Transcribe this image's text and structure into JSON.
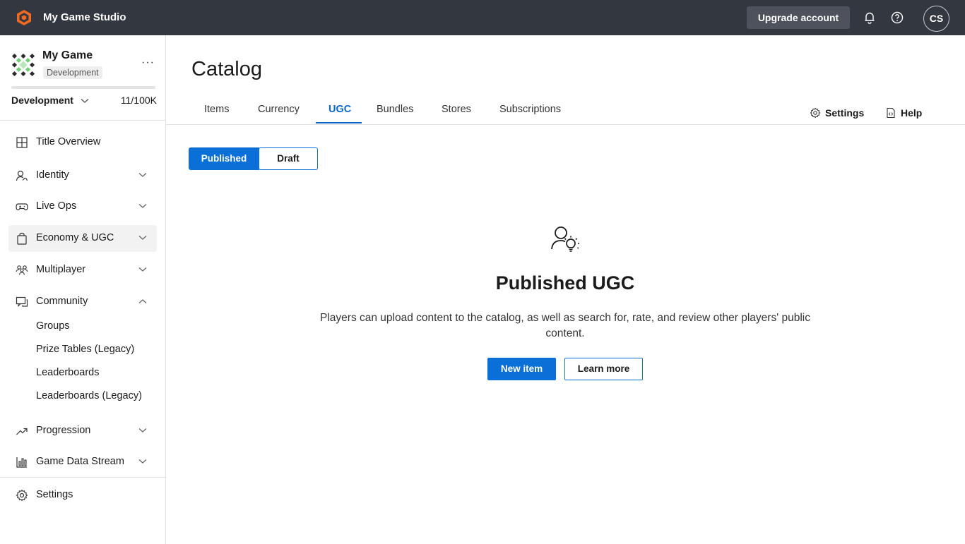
{
  "topbar": {
    "studio_name": "My Game Studio",
    "upgrade_label": "Upgrade account",
    "avatar_initials": "CS",
    "accent": "#f26a21",
    "icons": [
      "logo-icon",
      "bell-icon",
      "help-icon"
    ]
  },
  "sidebar": {
    "game_name": "My Game",
    "env_badge": "Development",
    "more_label": "···",
    "env_select": "Development",
    "usage_count": "11/100K",
    "usage_fraction": 0.00011,
    "items": [
      {
        "label": "Title Overview",
        "icon": "grid-icon"
      },
      {
        "label": "Identity",
        "icon": "identity-icon"
      },
      {
        "label": "Live Ops",
        "icon": "gamepad-icon"
      },
      {
        "label": "Economy & UGC",
        "icon": "bag-icon"
      },
      {
        "label": "Multiplayer",
        "icon": "people-icon"
      },
      {
        "label": "Community",
        "icon": "community-icon"
      },
      {
        "label": "Progression",
        "icon": "trend-icon"
      },
      {
        "label": "Game Data Stream",
        "icon": "bar-chart-icon"
      }
    ],
    "community_sub": [
      "Groups",
      "Prize Tables (Legacy)",
      "Leaderboards",
      "Leaderboards (Legacy)"
    ],
    "settings_label": "Settings"
  },
  "main": {
    "title": "Catalog",
    "tabs": [
      "Items",
      "Currency",
      "UGC",
      "Bundles",
      "Stores",
      "Subscriptions"
    ],
    "active_tab": "UGC",
    "settings_link": "Settings",
    "help_link": "Help",
    "segments": [
      "Published",
      "Draft"
    ],
    "empty_title": "Published UGC",
    "empty_desc": "Players can upload content to the catalog, as well as search for, rate, and review other players' public content.",
    "new_item_label": "New item",
    "learn_more_label": "Learn more"
  }
}
